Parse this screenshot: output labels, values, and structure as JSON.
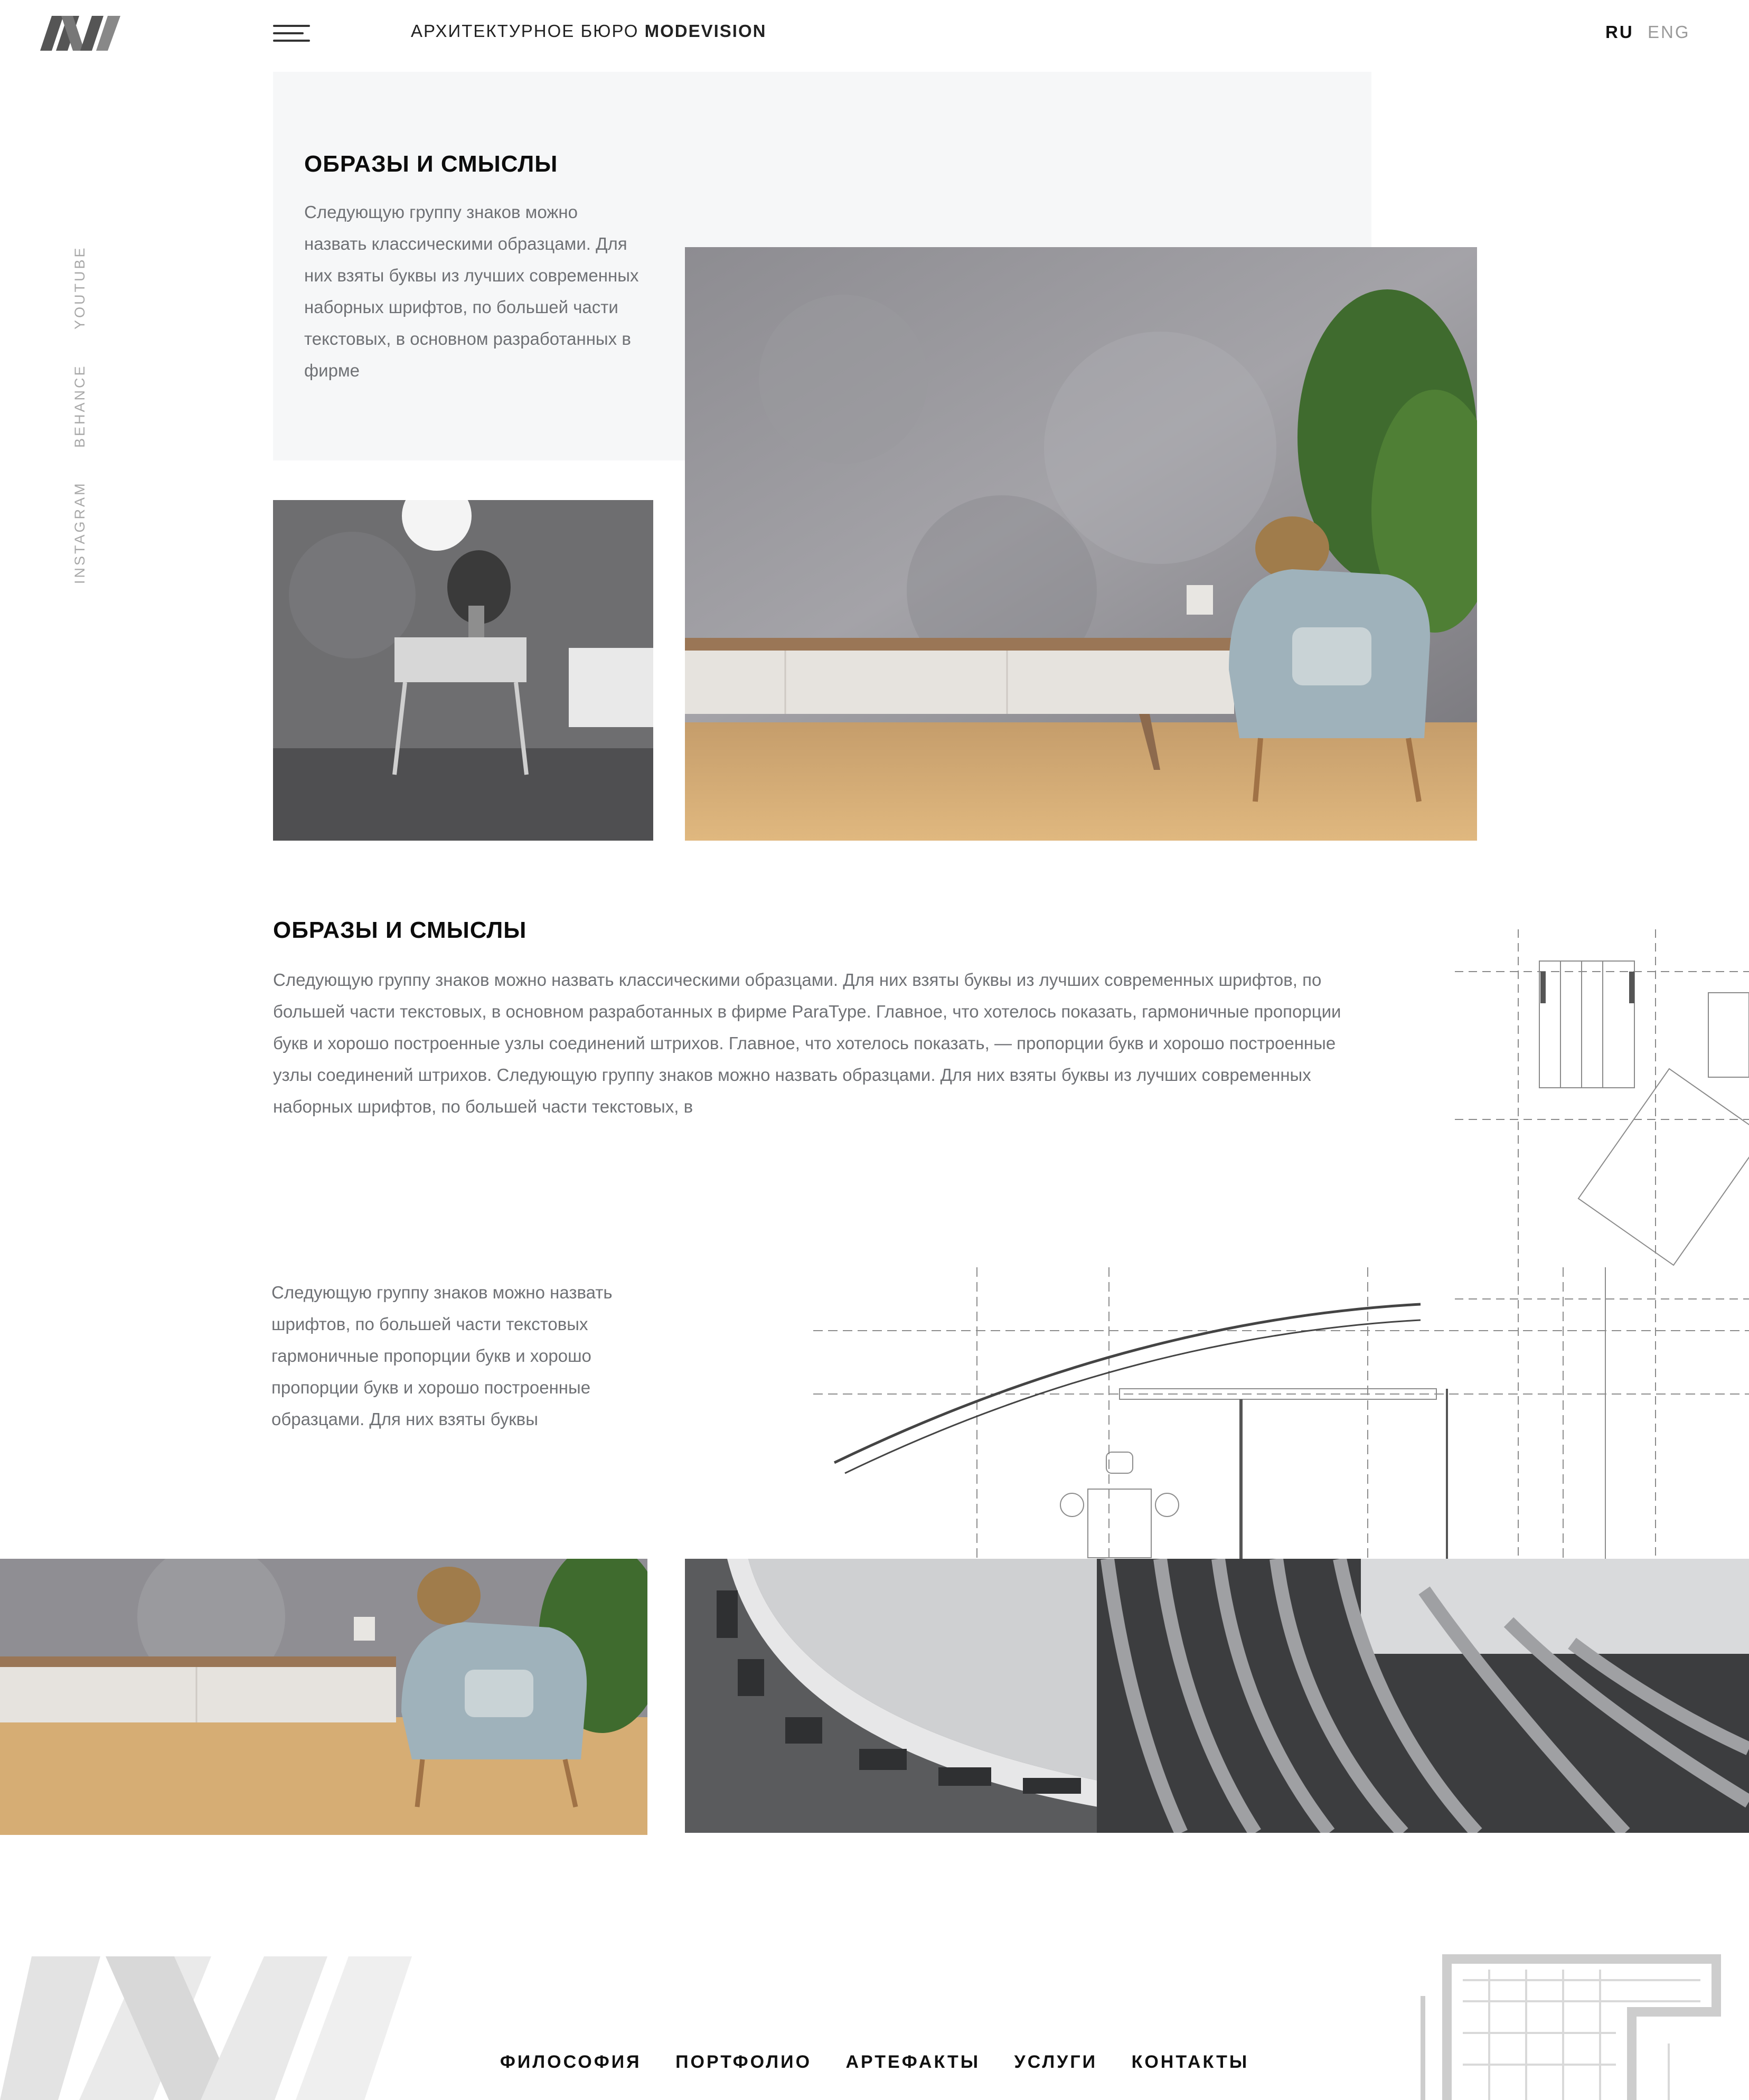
{
  "header": {
    "title_prefix": "АРХИТЕКТУРНОЕ БЮРО",
    "title_brand": "MODEVISION",
    "lang_ru": "RU",
    "lang_en": "ENG"
  },
  "social": {
    "youtube": "YOUTUBE",
    "behance": "BEHANCE",
    "instagram": "INSTAGRAM"
  },
  "section1": {
    "heading": "ОБРАЗЫ И СМЫСЛЫ",
    "text": "Следующую группу знаков можно назвать классическими образцами. Для них взяты буквы из лучших современных наборных шрифтов, по большей части текстовых, в основном разработанных в фирме"
  },
  "section2": {
    "heading": "ОБРАЗЫ И СМЫСЛЫ",
    "text": "Следующую группу знаков можно назвать классическими образцами. Для них взяты буквы из лучших современных шрифтов, по большей части текстовых, в основном разработанных в фирме ParaType. Главное, что хотелось показать, гармоничные пропорции букв и хорошо построенные узлы соединений штрихов. Главное, что хотелось показать, — пропорции букв и хорошо построенные узлы соединений штрихов. Следующую группу знаков можно назвать образцами. Для них взяты буквы из лучших современных наборных шрифтов, по большей части текстовых, в"
  },
  "section3": {
    "text": "Следующую группу знаков можно назвать шрифтов, по большей части текстовых гармоничные пропорции букв и хорошо пропорции букв и хорошо построенные образцами. Для них взяты буквы"
  },
  "footer": {
    "nav": [
      "ФИЛОСОФИЯ",
      "ПОРТФОЛИО",
      "АРТЕФАКТЫ",
      "УСЛУГИ",
      "КОНТАКТЫ"
    ]
  }
}
